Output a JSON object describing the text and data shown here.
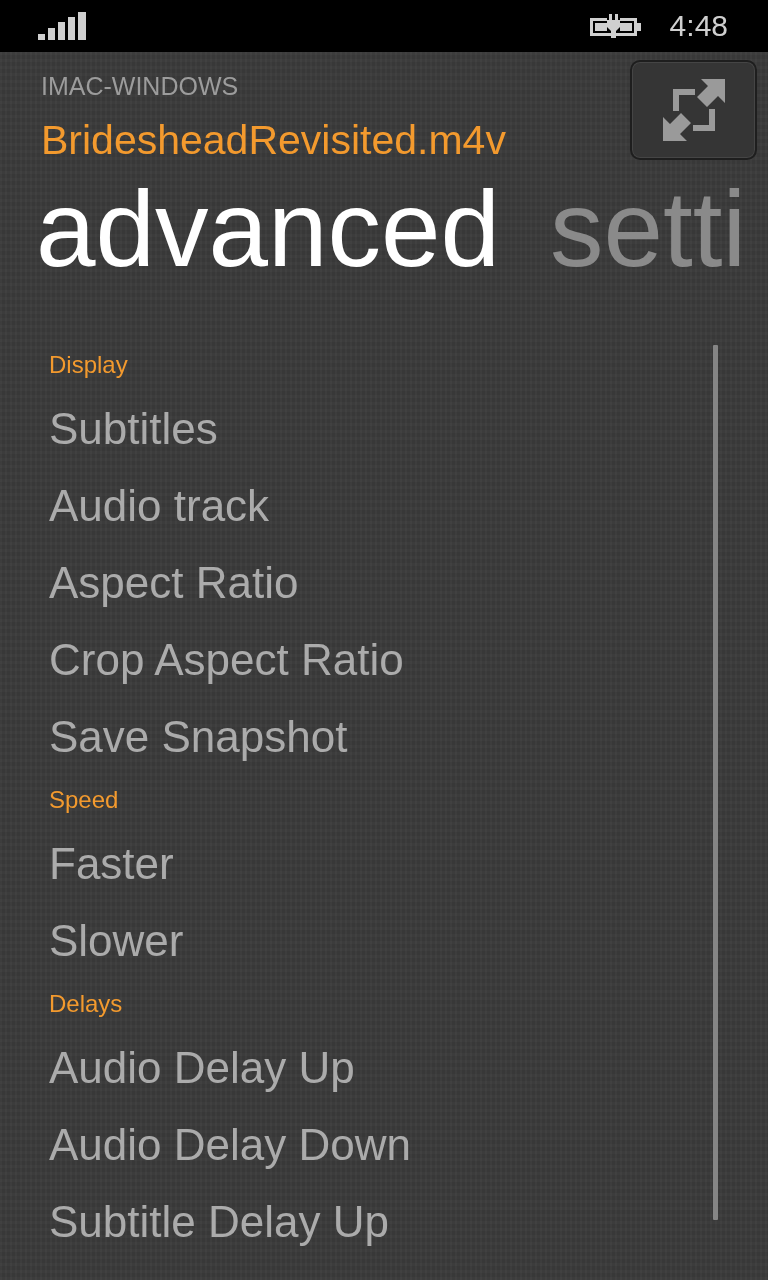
{
  "status_bar": {
    "time": "4:48"
  },
  "header": {
    "server": "IMAC-WINDOWS",
    "file": "BridesheadRevisited.m4v"
  },
  "pivot": [
    {
      "label": "advanced",
      "selected": true
    },
    {
      "label": "setti",
      "selected": false
    }
  ],
  "sections": [
    {
      "title": "Display",
      "items": [
        "Subtitles",
        "Audio track",
        "Aspect Ratio",
        "Crop Aspect Ratio",
        "Save Snapshot"
      ]
    },
    {
      "title": "Speed",
      "items": [
        "Faster",
        "Slower"
      ]
    },
    {
      "title": "Delays",
      "items": [
        "Audio Delay Up",
        "Audio Delay Down",
        "Subtitle Delay Up"
      ]
    }
  ]
}
